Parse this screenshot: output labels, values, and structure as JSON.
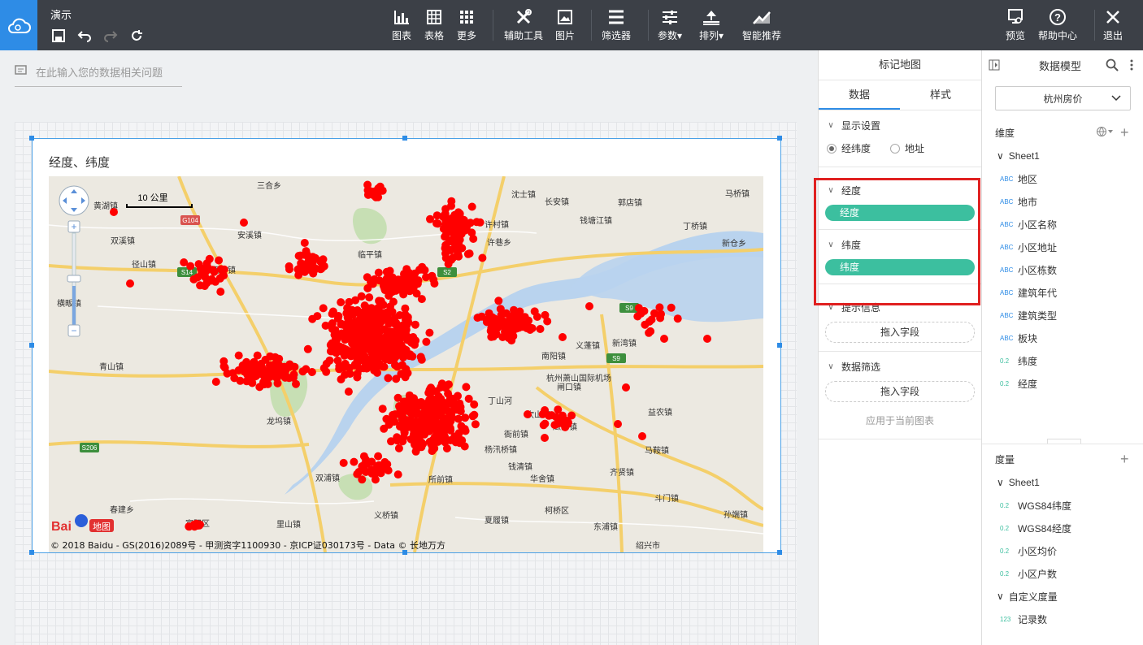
{
  "app": {
    "title": "演示"
  },
  "toolbar": {
    "center": [
      {
        "label": "图表",
        "icon": "bar-chart-icon"
      },
      {
        "label": "表格",
        "icon": "table-icon"
      },
      {
        "label": "更多",
        "icon": "grid-dots-icon"
      },
      {
        "label": "辅助工具",
        "icon": "tools-icon"
      },
      {
        "label": "图片",
        "icon": "image-icon"
      },
      {
        "label": "筛选器",
        "icon": "filter-icon"
      },
      {
        "label": "参数",
        "icon": "sliders-icon"
      },
      {
        "label": "排列",
        "icon": "arrange-icon"
      },
      {
        "label": "智能推荐",
        "icon": "recommend-icon"
      }
    ],
    "right": [
      {
        "label": "预览",
        "icon": "preview-icon"
      },
      {
        "label": "帮助中心",
        "icon": "help-icon"
      },
      {
        "label": "退出",
        "icon": "close-icon"
      }
    ]
  },
  "question_placeholder": "在此输入您的数据相关问题",
  "widget": {
    "title": "经度、纬度",
    "map": {
      "scale_label": "10 公里",
      "copyright": "© 2018 Baidu - GS(2016)2089号 - 甲测资字1100930 - 京ICP证030173号 - Data © 长地万方",
      "logo_text": "Bai",
      "logo_text2": "地图",
      "places": [
        "三合乡",
        "黄湖镇",
        "安溪镇",
        "双溪镇",
        "径山镇",
        "瓶窑镇",
        "横畈镇",
        "青山镇",
        "龙坞镇",
        "春建乡",
        "富阳区",
        "里山镇",
        "双浦镇",
        "义桥镇",
        "所前镇",
        "夏履镇",
        "柯桥区",
        "东浦镇",
        "绍兴市",
        "沈士镇",
        "长安镇",
        "郭店镇",
        "马桥镇",
        "许村镇",
        "钱塘江镇",
        "丁桥镇",
        "许巷乡",
        "新仓乡",
        "南阳镇",
        "义蓬镇",
        "新湾镇",
        "杭州萧山国际机场",
        "益农镇",
        "坎山镇",
        "衙前镇",
        "杨汛桥镇",
        "马鞍镇",
        "钱清镇",
        "齐贤镇",
        "华舍镇",
        "斗门镇",
        "孙端镇",
        "瓜沥镇",
        "闸口镇",
        "临平镇",
        "丁山河"
      ],
      "road_badges": [
        "G104",
        "S14",
        "S2",
        "S9",
        "S9",
        "S206"
      ]
    }
  },
  "settings_panel": {
    "title": "标记地图",
    "tabs": [
      "数据",
      "样式"
    ],
    "display": {
      "label": "显示设置",
      "options": [
        "经纬度",
        "地址"
      ],
      "selected": "经纬度"
    },
    "longitude": {
      "label": "经度",
      "field": "经度"
    },
    "latitude": {
      "label": "纬度",
      "field": "纬度"
    },
    "tooltip": {
      "label": "提示信息",
      "drop": "拖入字段"
    },
    "filter": {
      "label": "数据筛选",
      "drop": "拖入字段",
      "apply": "应用于当前图表"
    }
  },
  "model_panel": {
    "title": "数据模型",
    "dataset": "杭州房价",
    "dimensions_label": "维度",
    "dim_sheet": "Sheet1",
    "dimensions": [
      {
        "type": "ABC",
        "name": "地区"
      },
      {
        "type": "ABC",
        "name": "地市"
      },
      {
        "type": "ABC",
        "name": "小区名称"
      },
      {
        "type": "ABC",
        "name": "小区地址"
      },
      {
        "type": "ABC",
        "name": "小区栋数"
      },
      {
        "type": "ABC",
        "name": "建筑年代"
      },
      {
        "type": "ABC",
        "name": "建筑类型"
      },
      {
        "type": "ABC",
        "name": "板块"
      },
      {
        "type": "0.2",
        "name": "纬度"
      },
      {
        "type": "0.2",
        "name": "经度"
      }
    ],
    "measures_label": "度量",
    "meas_sheet": "Sheet1",
    "measures": [
      {
        "type": "0.2",
        "name": "WGS84纬度"
      },
      {
        "type": "0.2",
        "name": "WGS84经度"
      },
      {
        "type": "0.2",
        "name": "小区均价"
      },
      {
        "type": "0.2",
        "name": "小区户数"
      }
    ],
    "custom_label": "自定义度量",
    "custom": [
      {
        "type": "123",
        "name": "记录数"
      }
    ]
  },
  "colors": {
    "accent": "#2e8ce6",
    "pill": "#3cbf9f",
    "marker": "#ff0000",
    "highlight": "#e02020"
  }
}
